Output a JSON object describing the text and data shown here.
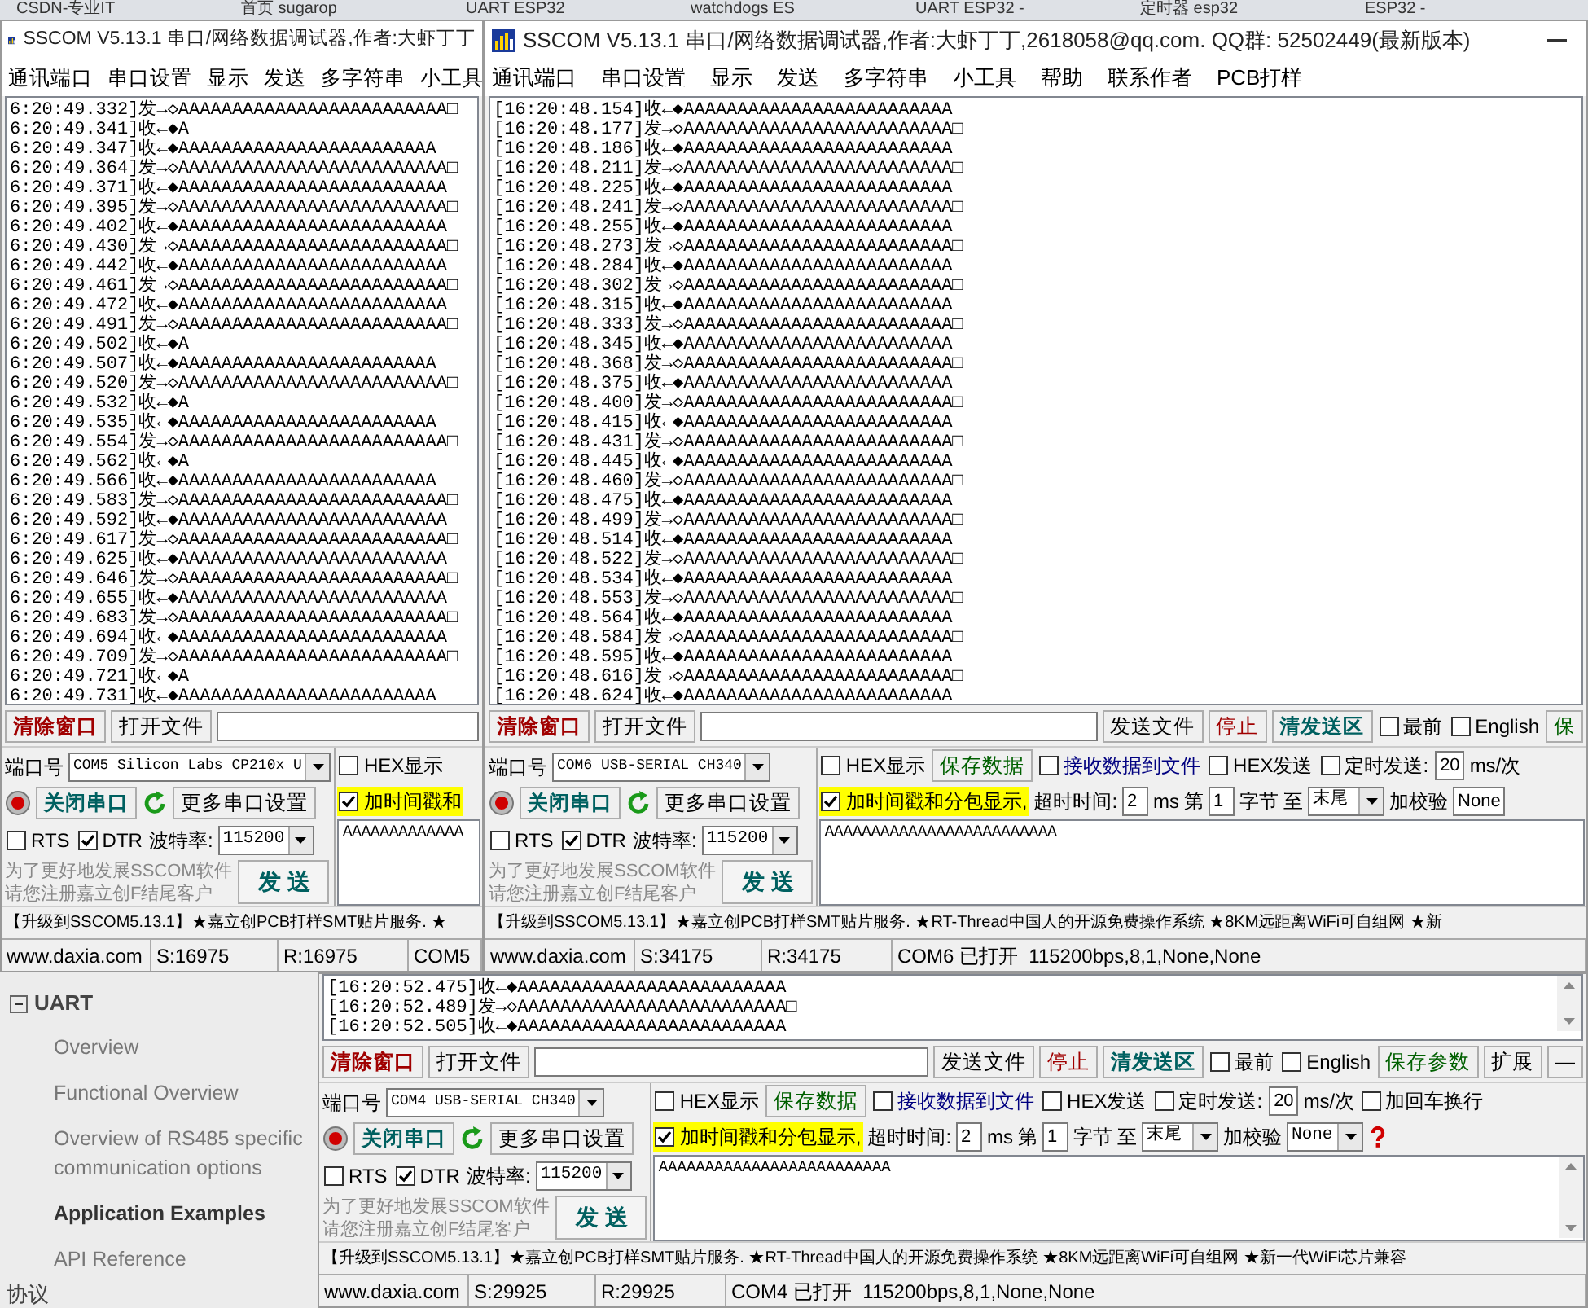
{
  "browser_tabs": [
    "CSDN-专业IT",
    "首页 sugarop",
    "UART ESP32",
    "watchdogs ES",
    "UART ESP32 -",
    "定时器 esp32",
    "ESP32 -"
  ],
  "docs_sidebar": {
    "section": "UART",
    "expanded": true,
    "items": [
      {
        "label": "Overview",
        "selected": false
      },
      {
        "label": "Functional Overview",
        "selected": false
      },
      {
        "label": "Overview of RS485 specific communication options",
        "selected": false
      },
      {
        "label": "Application Examples",
        "selected": true
      },
      {
        "label": "API Reference",
        "selected": false
      }
    ],
    "next_section": "协议"
  },
  "windows": [
    {
      "title": "SSCOM V5.13.1 串口/网络数据调试器,作者:大虾丁丁",
      "menu": [
        "通讯端口",
        "串口设置",
        "显示",
        "发送",
        "多字符串",
        "小工具"
      ],
      "log": [
        "6:20:49.332]发→◇AAAAAAAAAAAAAAAAAAAAAAAAA□",
        "6:20:49.341]收←◆A",
        "6:20:49.347]收←◆AAAAAAAAAAAAAAAAAAAAAAAA",
        "6:20:49.364]发→◇AAAAAAAAAAAAAAAAAAAAAAAAA□",
        "6:20:49.371]收←◆AAAAAAAAAAAAAAAAAAAAAAAAA",
        "6:20:49.395]发→◇AAAAAAAAAAAAAAAAAAAAAAAAA□",
        "6:20:49.402]收←◆AAAAAAAAAAAAAAAAAAAAAAAAA",
        "6:20:49.430]发→◇AAAAAAAAAAAAAAAAAAAAAAAAA□",
        "6:20:49.442]收←◆AAAAAAAAAAAAAAAAAAAAAAAAA",
        "6:20:49.461]发→◇AAAAAAAAAAAAAAAAAAAAAAAAA□",
        "6:20:49.472]收←◆AAAAAAAAAAAAAAAAAAAAAAAAA",
        "6:20:49.491]发→◇AAAAAAAAAAAAAAAAAAAAAAAAA□",
        "6:20:49.502]收←◆A",
        "6:20:49.507]收←◆AAAAAAAAAAAAAAAAAAAAAAAA",
        "6:20:49.520]发→◇AAAAAAAAAAAAAAAAAAAAAAAAA□",
        "6:20:49.532]收←◆A",
        "6:20:49.535]收←◆AAAAAAAAAAAAAAAAAAAAAAAA",
        "6:20:49.554]发→◇AAAAAAAAAAAAAAAAAAAAAAAAA□",
        "6:20:49.562]收←◆A",
        "6:20:49.566]收←◆AAAAAAAAAAAAAAAAAAAAAAAA",
        "6:20:49.583]发→◇AAAAAAAAAAAAAAAAAAAAAAAAA□",
        "6:20:49.592]收←◆AAAAAAAAAAAAAAAAAAAAAAAAA",
        "6:20:49.617]发→◇AAAAAAAAAAAAAAAAAAAAAAAAA□",
        "6:20:49.625]收←◆AAAAAAAAAAAAAAAAAAAAAAAAA",
        "6:20:49.646]发→◇AAAAAAAAAAAAAAAAAAAAAAAAA□",
        "6:20:49.655]收←◆AAAAAAAAAAAAAAAAAAAAAAAAA",
        "6:20:49.683]发→◇AAAAAAAAAAAAAAAAAAAAAAAAA□",
        "6:20:49.694]收←◆AAAAAAAAAAAAAAAAAAAAAAAAA",
        "6:20:49.709]发→◇AAAAAAAAAAAAAAAAAAAAAAAAA□",
        "6:20:49.721]收←◆A",
        "6:20:49.731]收←◆AAAAAAAAAAAAAAAAAAAAAAAA"
      ],
      "toolbar": [
        {
          "kind": "alert_button",
          "label": "清除窗口"
        },
        {
          "kind": "button",
          "label": "打开文件"
        },
        {
          "kind": "field"
        }
      ],
      "controls": [
        [
          {
            "kind": "label",
            "text": "端口号"
          },
          {
            "kind": "select",
            "value": "COM5 Silicon Labs CP210x U"
          }
        ],
        [
          {
            "kind": "led"
          },
          {
            "kind": "port_button",
            "label": "关闭串口"
          },
          {
            "kind": "refresh"
          },
          {
            "kind": "button",
            "label": "更多串口设置"
          }
        ],
        [
          {
            "kind": "checkbox",
            "label": "RTS",
            "checked": false
          },
          {
            "kind": "checkbox",
            "label": "DTR",
            "checked": true
          },
          {
            "kind": "label",
            "text": "波特率:"
          },
          {
            "kind": "select",
            "value": "115200"
          }
        ]
      ],
      "promo": [
        "为了更好地发展SSCOM软件",
        "请您注册嘉立创F结尾客户"
      ],
      "send_button": "发 送",
      "options": [
        [
          {
            "kind": "checkbox",
            "label": "HEX显示",
            "checked": false
          }
        ],
        [
          {
            "kind": "checkbox",
            "label": "加时间戳和",
            "checked": true,
            "highlighted": true
          }
        ]
      ],
      "send_text": "AAAAAAAAAAAAA",
      "ticker": "【升级到SSCOM5.13.1】★嘉立创PCB打样SMT贴片服务. ★",
      "status": [
        "www.daxia.com",
        "S:16975",
        "R:16975",
        "COM5"
      ]
    },
    {
      "title": "SSCOM V5.13.1 串口/网络数据调试器,作者:大虾丁丁,2618058@qq.com. QQ群: 52502449(最新版本)",
      "menu": [
        "通讯端口",
        "串口设置",
        "显示",
        "发送",
        "多字符串",
        "小工具",
        "帮助",
        "联系作者",
        "PCB打样"
      ],
      "log": [
        "[16:20:48.154]收←◆AAAAAAAAAAAAAAAAAAAAAAAAA",
        "[16:20:48.177]发→◇AAAAAAAAAAAAAAAAAAAAAAAAA□",
        "[16:20:48.186]收←◆AAAAAAAAAAAAAAAAAAAAAAAAA",
        "[16:20:48.211]发→◇AAAAAAAAAAAAAAAAAAAAAAAAA□",
        "[16:20:48.225]收←◆AAAAAAAAAAAAAAAAAAAAAAAAA",
        "[16:20:48.241]发→◇AAAAAAAAAAAAAAAAAAAAAAAAA□",
        "[16:20:48.255]收←◆AAAAAAAAAAAAAAAAAAAAAAAAA",
        "[16:20:48.273]发→◇AAAAAAAAAAAAAAAAAAAAAAAAA□",
        "[16:20:48.284]收←◆AAAAAAAAAAAAAAAAAAAAAAAAA",
        "[16:20:48.302]发→◇AAAAAAAAAAAAAAAAAAAAAAAAA□",
        "[16:20:48.315]收←◆AAAAAAAAAAAAAAAAAAAAAAAAA",
        "[16:20:48.333]发→◇AAAAAAAAAAAAAAAAAAAAAAAAA□",
        "[16:20:48.345]收←◆AAAAAAAAAAAAAAAAAAAAAAAAA",
        "[16:20:48.368]发→◇AAAAAAAAAAAAAAAAAAAAAAAAA□",
        "[16:20:48.375]收←◆AAAAAAAAAAAAAAAAAAAAAAAAA",
        "[16:20:48.400]发→◇AAAAAAAAAAAAAAAAAAAAAAAAA□",
        "[16:20:48.415]收←◆AAAAAAAAAAAAAAAAAAAAAAAAA",
        "[16:20:48.431]发→◇AAAAAAAAAAAAAAAAAAAAAAAAA□",
        "[16:20:48.445]收←◆AAAAAAAAAAAAAAAAAAAAAAAAA",
        "[16:20:48.460]发→◇AAAAAAAAAAAAAAAAAAAAAAAAA□",
        "[16:20:48.475]收←◆AAAAAAAAAAAAAAAAAAAAAAAAA",
        "[16:20:48.499]发→◇AAAAAAAAAAAAAAAAAAAAAAAAA□",
        "[16:20:48.514]收←◆AAAAAAAAAAAAAAAAAAAAAAAAA",
        "[16:20:48.522]发→◇AAAAAAAAAAAAAAAAAAAAAAAAA□",
        "[16:20:48.534]收←◆AAAAAAAAAAAAAAAAAAAAAAAAA",
        "[16:20:48.553]发→◇AAAAAAAAAAAAAAAAAAAAAAAAA□",
        "[16:20:48.564]收←◆AAAAAAAAAAAAAAAAAAAAAAAAA",
        "[16:20:48.584]发→◇AAAAAAAAAAAAAAAAAAAAAAAAA□",
        "[16:20:48.595]收←◆AAAAAAAAAAAAAAAAAAAAAAAAA",
        "[16:20:48.616]发→◇AAAAAAAAAAAAAAAAAAAAAAAAA□",
        "[16:20:48.624]收←◆AAAAAAAAAAAAAAAAAAAAAAAAA"
      ],
      "toolbar": [
        {
          "kind": "alert_button",
          "label": "清除窗口"
        },
        {
          "kind": "button",
          "label": "打开文件"
        },
        {
          "kind": "field"
        },
        {
          "kind": "button",
          "label": "发送文件"
        },
        {
          "kind": "stop_button",
          "label": "停止"
        },
        {
          "kind": "port_button",
          "label": "清发送区"
        },
        {
          "kind": "checkbox",
          "label": "最前",
          "checked": false
        },
        {
          "kind": "checkbox",
          "label": "English",
          "checked": false
        },
        {
          "kind": "save_button",
          "label": "保"
        }
      ],
      "controls": [
        [
          {
            "kind": "label",
            "text": "端口号"
          },
          {
            "kind": "select",
            "value": "COM6 USB-SERIAL CH340"
          }
        ],
        [
          {
            "kind": "led"
          },
          {
            "kind": "port_button",
            "label": "关闭串口"
          },
          {
            "kind": "refresh"
          },
          {
            "kind": "button",
            "label": "更多串口设置"
          }
        ],
        [
          {
            "kind": "checkbox",
            "label": "RTS",
            "checked": false
          },
          {
            "kind": "checkbox",
            "label": "DTR",
            "checked": true
          },
          {
            "kind": "label",
            "text": "波特率:"
          },
          {
            "kind": "select",
            "value": "115200"
          }
        ]
      ],
      "promo": [
        "为了更好地发展SSCOM软件",
        "请您注册嘉立创F结尾客户"
      ],
      "send_button": "发 送",
      "options": [
        [
          {
            "kind": "checkbox",
            "label": "HEX显示",
            "checked": false
          },
          {
            "kind": "save_button",
            "label": "保存数据"
          },
          {
            "kind": "file_checkbox",
            "label": "接收数据到文件",
            "checked": false
          },
          {
            "kind": "checkbox",
            "label": "HEX发送",
            "checked": false
          },
          {
            "kind": "checkbox",
            "label": "定时发送:",
            "checked": false
          },
          {
            "kind": "field",
            "value": "20"
          },
          {
            "kind": "label",
            "text": "ms/次"
          }
        ],
        [
          {
            "kind": "checkbox",
            "label": "加时间戳和分包显示,",
            "checked": true,
            "highlighted": true
          },
          {
            "kind": "label",
            "text": "超时时间:"
          },
          {
            "kind": "field",
            "value": "2"
          },
          {
            "kind": "label",
            "text": "ms"
          },
          {
            "kind": "label",
            "text": "第"
          },
          {
            "kind": "field",
            "value": "1"
          },
          {
            "kind": "label",
            "text": "字节"
          },
          {
            "kind": "label",
            "text": "至"
          },
          {
            "kind": "select",
            "value": "末尾"
          },
          {
            "kind": "label",
            "text": "加校验"
          },
          {
            "kind": "field",
            "value": "None"
          }
        ]
      ],
      "send_text": "AAAAAAAAAAAAAAAAAAAAAAAAA",
      "ticker": "【升级到SSCOM5.13.1】★嘉立创PCB打样SMT贴片服务. ★RT-Thread中国人的开源免费操作系统 ★8KM远距离WiFi可自组网 ★新",
      "status": [
        "www.daxia.com",
        "S:34175",
        "R:34175",
        "COM6 已打开  115200bps,8,1,None,None"
      ]
    },
    {
      "log": [
        "[16:20:52.475]收←◆AAAAAAAAAAAAAAAAAAAAAAAAA",
        "[16:20:52.489]发→◇AAAAAAAAAAAAAAAAAAAAAAAAA□",
        "[16:20:52.505]收←◆AAAAAAAAAAAAAAAAAAAAAAAAA"
      ],
      "toolbar": [
        {
          "kind": "alert_button",
          "label": "清除窗口"
        },
        {
          "kind": "button",
          "label": "打开文件"
        },
        {
          "kind": "field"
        },
        {
          "kind": "button",
          "label": "发送文件"
        },
        {
          "kind": "stop_button",
          "label": "停止"
        },
        {
          "kind": "port_button",
          "label": "清发送区"
        },
        {
          "kind": "checkbox",
          "label": "最前",
          "checked": false
        },
        {
          "kind": "checkbox",
          "label": "English",
          "checked": false
        },
        {
          "kind": "save_button",
          "label": "保存参数"
        },
        {
          "kind": "button",
          "label": "扩展"
        },
        {
          "kind": "button",
          "label": "—"
        }
      ],
      "controls": [
        [
          {
            "kind": "label",
            "text": "端口号"
          },
          {
            "kind": "select",
            "value": "COM4 USB-SERIAL CH340"
          }
        ],
        [
          {
            "kind": "led"
          },
          {
            "kind": "port_button",
            "label": "关闭串口"
          },
          {
            "kind": "refresh"
          },
          {
            "kind": "button",
            "label": "更多串口设置"
          }
        ],
        [
          {
            "kind": "checkbox",
            "label": "RTS",
            "checked": false
          },
          {
            "kind": "checkbox",
            "label": "DTR",
            "checked": true
          },
          {
            "kind": "label",
            "text": "波特率:"
          },
          {
            "kind": "select",
            "value": "115200"
          }
        ]
      ],
      "promo": [
        "为了更好地发展SSCOM软件",
        "请您注册嘉立创F结尾客户"
      ],
      "send_button": "发 送",
      "options": [
        [
          {
            "kind": "checkbox",
            "label": "HEX显示",
            "checked": false
          },
          {
            "kind": "save_button",
            "label": "保存数据"
          },
          {
            "kind": "file_checkbox",
            "label": "接收数据到文件",
            "checked": false
          },
          {
            "kind": "checkbox",
            "label": "HEX发送",
            "checked": false
          },
          {
            "kind": "checkbox",
            "label": "定时发送:",
            "checked": false
          },
          {
            "kind": "field",
            "value": "20"
          },
          {
            "kind": "label",
            "text": "ms/次"
          },
          {
            "kind": "checkbox",
            "label": "加回车换行",
            "checked": false
          }
        ],
        [
          {
            "kind": "checkbox",
            "label": "加时间戳和分包显示,",
            "checked": true,
            "highlighted": true
          },
          {
            "kind": "label",
            "text": "超时时间:"
          },
          {
            "kind": "field",
            "value": "2"
          },
          {
            "kind": "label",
            "text": "ms"
          },
          {
            "kind": "label",
            "text": "第"
          },
          {
            "kind": "field",
            "value": "1"
          },
          {
            "kind": "label",
            "text": "字节"
          },
          {
            "kind": "label",
            "text": "至"
          },
          {
            "kind": "select",
            "value": "末尾"
          },
          {
            "kind": "label",
            "text": "加校验"
          },
          {
            "kind": "select",
            "value": "None"
          },
          {
            "kind": "help"
          }
        ]
      ],
      "send_text": "AAAAAAAAAAAAAAAAAAAAAAAAA",
      "ticker": "【升级到SSCOM5.13.1】★嘉立创PCB打样SMT贴片服务. ★RT-Thread中国人的开源免费操作系统 ★8KM远距离WiFi可自组网 ★新一代WiFi芯片兼容",
      "status": [
        "www.daxia.com",
        "S:29925",
        "R:29925",
        "COM4 已打开  115200bps,8,1,None,None"
      ]
    }
  ]
}
